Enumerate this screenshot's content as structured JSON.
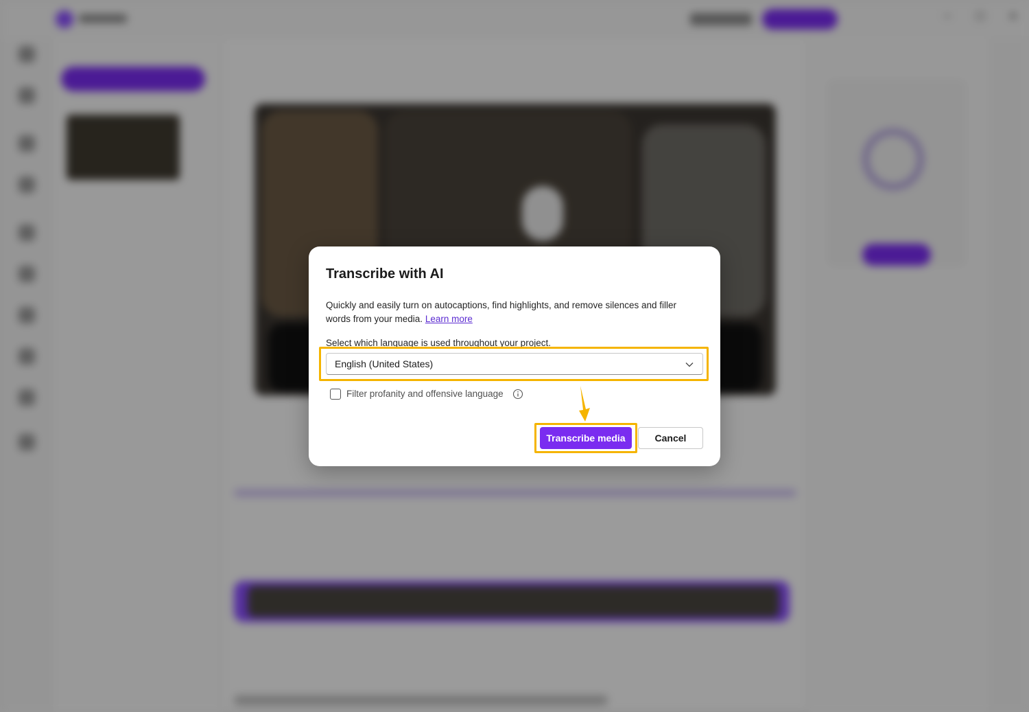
{
  "window": {
    "controls": {
      "minimize": "─",
      "maximize": "☐",
      "close": "✕"
    }
  },
  "dialog": {
    "title": "Transcribe with AI",
    "description": "Quickly and easily turn on autocaptions, find highlights, and remove silences and filler words from your media.",
    "learn_more": "Learn more",
    "language_label": "Select which language is used throughout your project.",
    "language_value": "English (United States)",
    "filter_label": "Filter profanity and offensive language",
    "filter_checked": false,
    "primary_button": "Transcribe media",
    "cancel_button": "Cancel"
  },
  "colors": {
    "accent": "#7a2cf0",
    "highlight": "#f5b400",
    "link": "#5b2bd1"
  },
  "icons": {
    "dropdown": "chevron-down-icon",
    "info": "info-icon",
    "annotation": "arrow-down-icon"
  }
}
